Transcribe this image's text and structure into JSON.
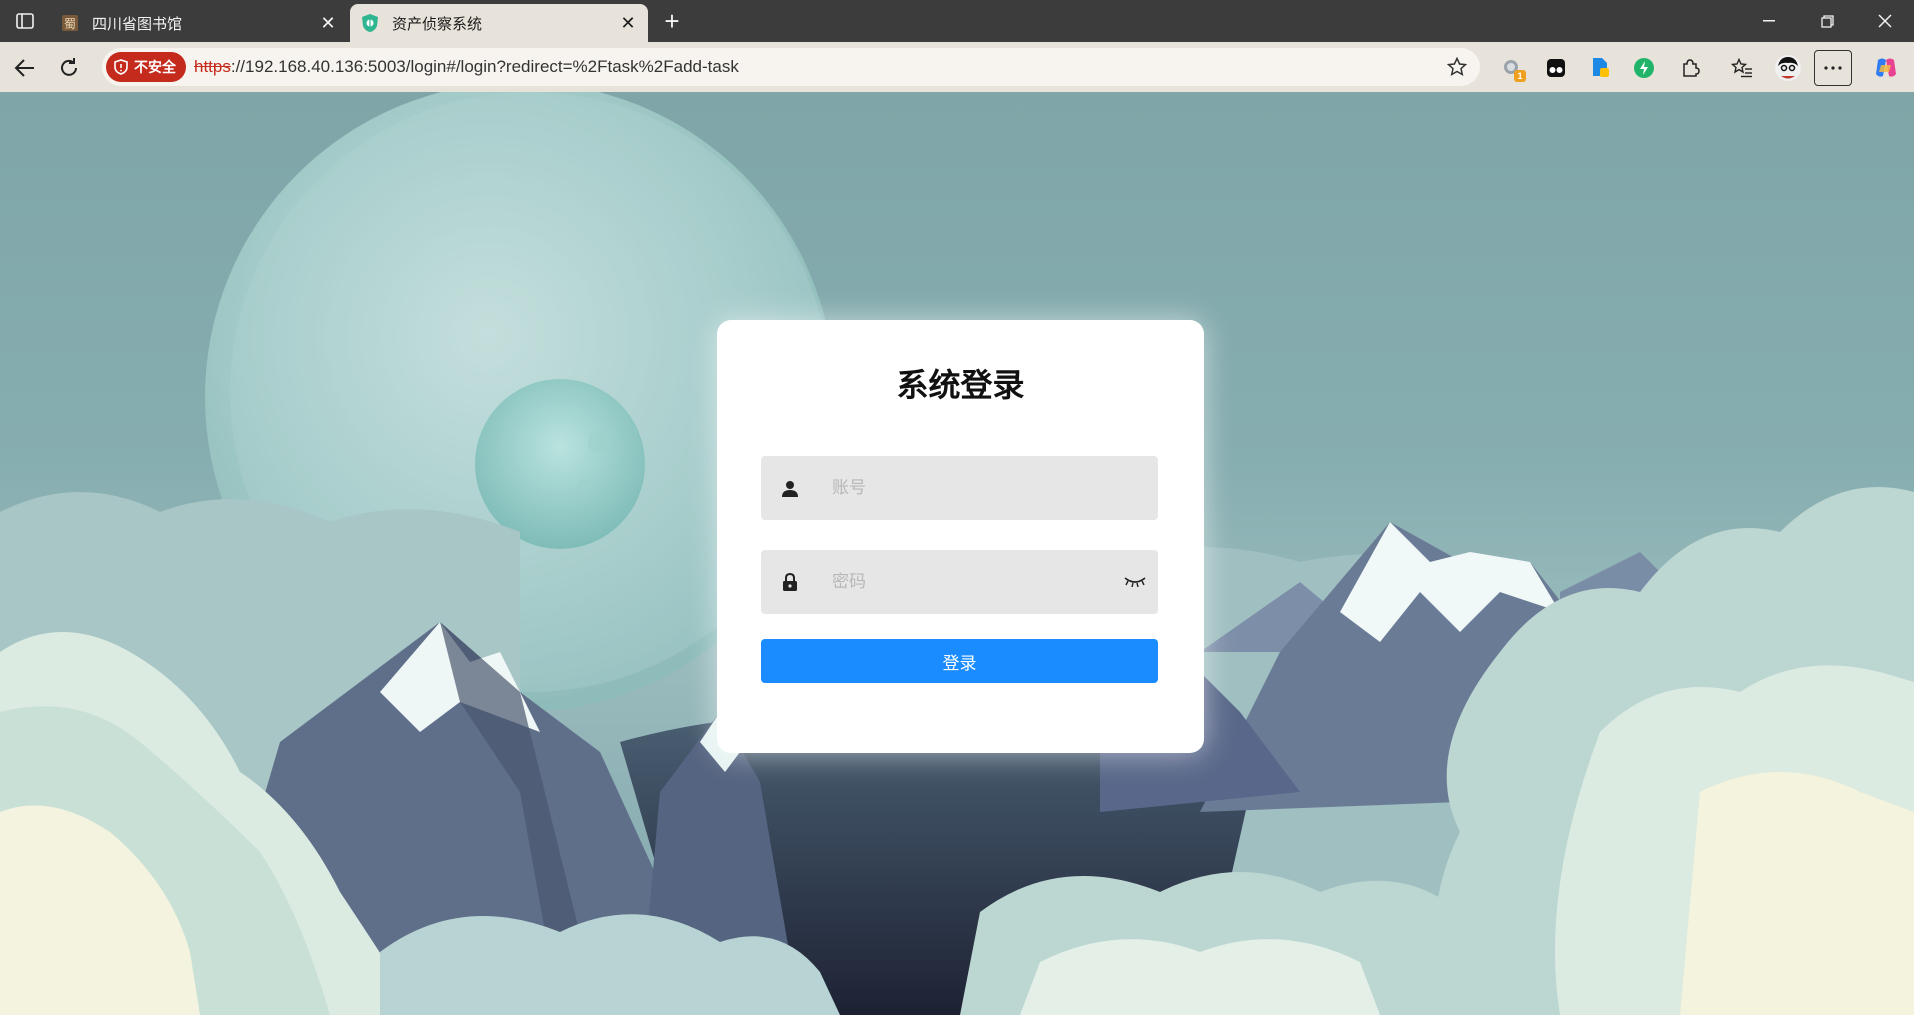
{
  "browser": {
    "tabs": [
      {
        "title": "四川省图书馆",
        "active": false,
        "favicon": "library-seal-icon"
      },
      {
        "title": "资产侦察系统",
        "active": true,
        "favicon": "bug-shield-icon"
      }
    ],
    "new_tab_label": "+",
    "security_badge": "不安全",
    "url_scheme": "https",
    "url_rest": "://192.168.40.136:5003/login#/login?redirect=%2Ftask%2Fadd-task",
    "extension_badge_count": "1"
  },
  "login": {
    "title": "系统登录",
    "username_placeholder": "账号",
    "password_placeholder": "密码",
    "submit_label": "登录"
  },
  "colors": {
    "primary_button": "#1a8cff",
    "insecure_badge": "#c42b1c",
    "field_background": "#e6e6e6"
  }
}
